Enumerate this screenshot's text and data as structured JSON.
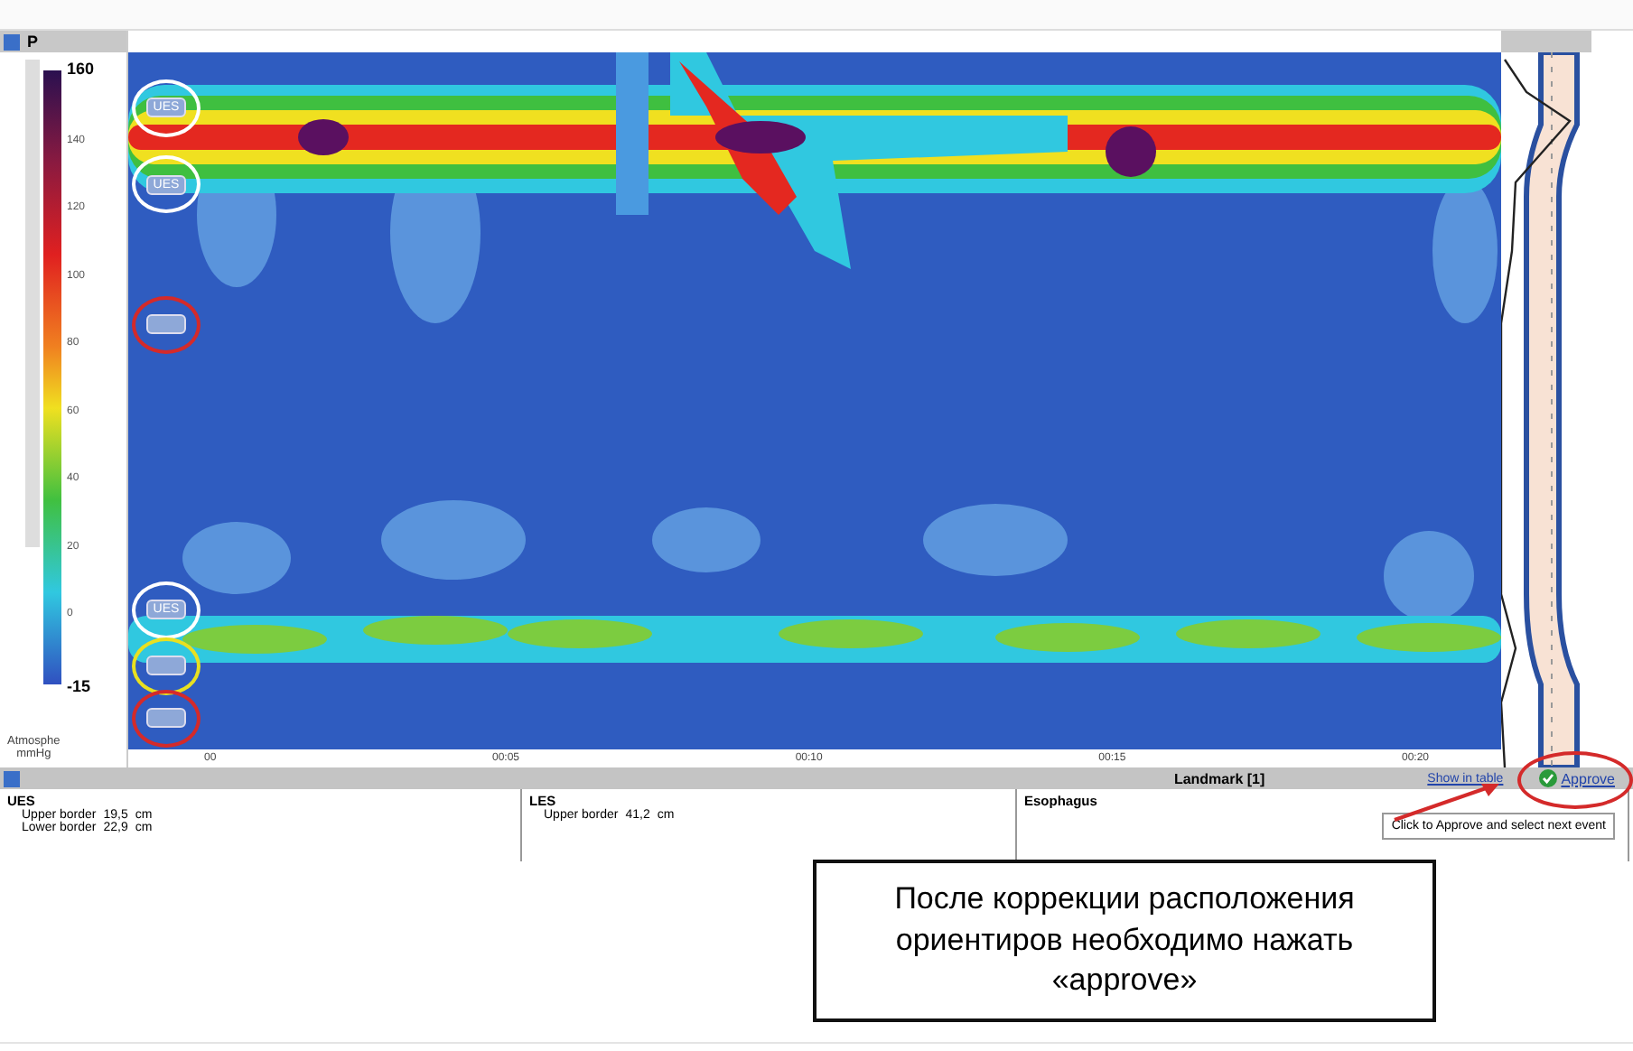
{
  "left_panel": {
    "title": "P"
  },
  "color_scale": {
    "ticks": [
      "160",
      "140",
      "120",
      "100",
      "80",
      "60",
      "40",
      "20",
      "0",
      "-15"
    ],
    "unit_lines": [
      "Atmosphe",
      "mmHg"
    ]
  },
  "markers": [
    {
      "label": "UES",
      "color": "#ffffff"
    },
    {
      "label": "UES",
      "color": "#ffffff"
    },
    {
      "color": "#d42a2a"
    },
    {
      "label": "UES",
      "color": "#ffffff"
    },
    {
      "color": "#e8e020"
    },
    {
      "color": "#d42a2a"
    }
  ],
  "time_ticks": [
    "00",
    "00:05",
    "00:10",
    "00:15",
    "00:20"
  ],
  "landmark_bar": {
    "title": "Landmark [1]",
    "show_in_table": "Show in table",
    "approve": "Approve"
  },
  "info_panels": [
    {
      "title": "UES",
      "rows": [
        {
          "label": "Upper border",
          "value": "19,5",
          "unit": "cm"
        },
        {
          "label": "Lower border",
          "value": "22,9",
          "unit": "cm"
        }
      ]
    },
    {
      "title": "LES",
      "rows": [
        {
          "label": "Upper border",
          "value": "41,2",
          "unit": "cm"
        }
      ]
    },
    {
      "title": "Esophagus"
    }
  ],
  "tooltip": "Click to Approve and select next event",
  "callout": "После коррекции расположения ориентиров необходимо нажать «approve»"
}
